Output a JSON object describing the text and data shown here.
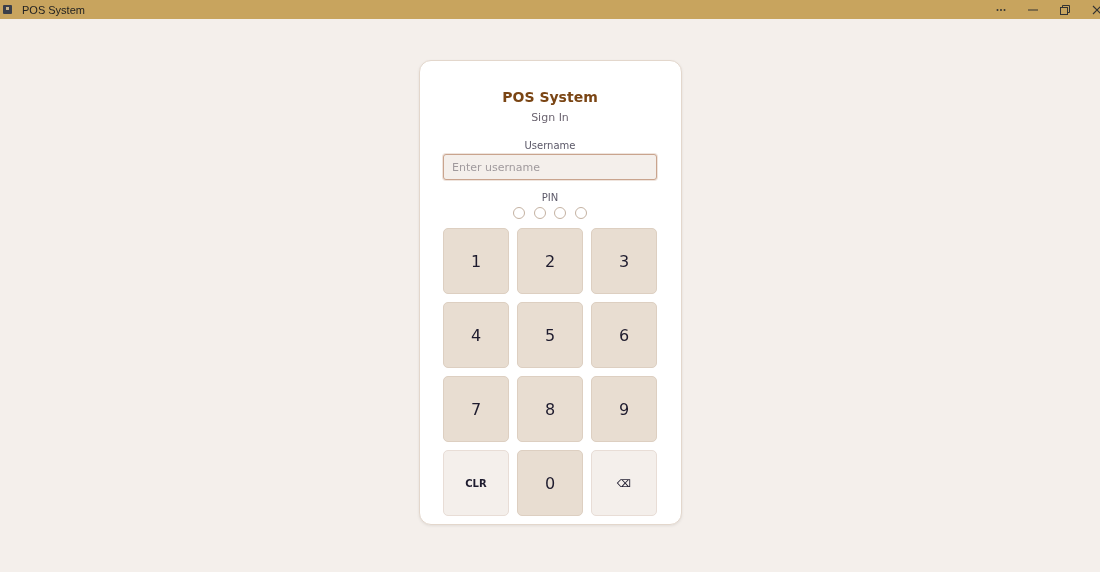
{
  "window": {
    "title": "POS System"
  },
  "card": {
    "title": "POS System",
    "subtitle": "Sign In"
  },
  "username": {
    "label": "Username",
    "placeholder": "Enter username"
  },
  "pin": {
    "label": "PIN",
    "dots": [
      {
        "filled": false
      },
      {
        "filled": false
      },
      {
        "filled": false
      },
      {
        "filled": false
      }
    ]
  },
  "keys": [
    {
      "label": "1",
      "kind": "digit"
    },
    {
      "label": "2",
      "kind": "digit"
    },
    {
      "label": "3",
      "kind": "digit"
    },
    {
      "label": "4",
      "kind": "digit"
    },
    {
      "label": "5",
      "kind": "digit"
    },
    {
      "label": "6",
      "kind": "digit"
    },
    {
      "label": "7",
      "kind": "digit"
    },
    {
      "label": "8",
      "kind": "digit"
    },
    {
      "label": "9",
      "kind": "digit"
    },
    {
      "label": "CLR",
      "kind": "action"
    },
    {
      "label": "0",
      "kind": "digit"
    },
    {
      "label": "⌫",
      "kind": "action"
    }
  ]
}
